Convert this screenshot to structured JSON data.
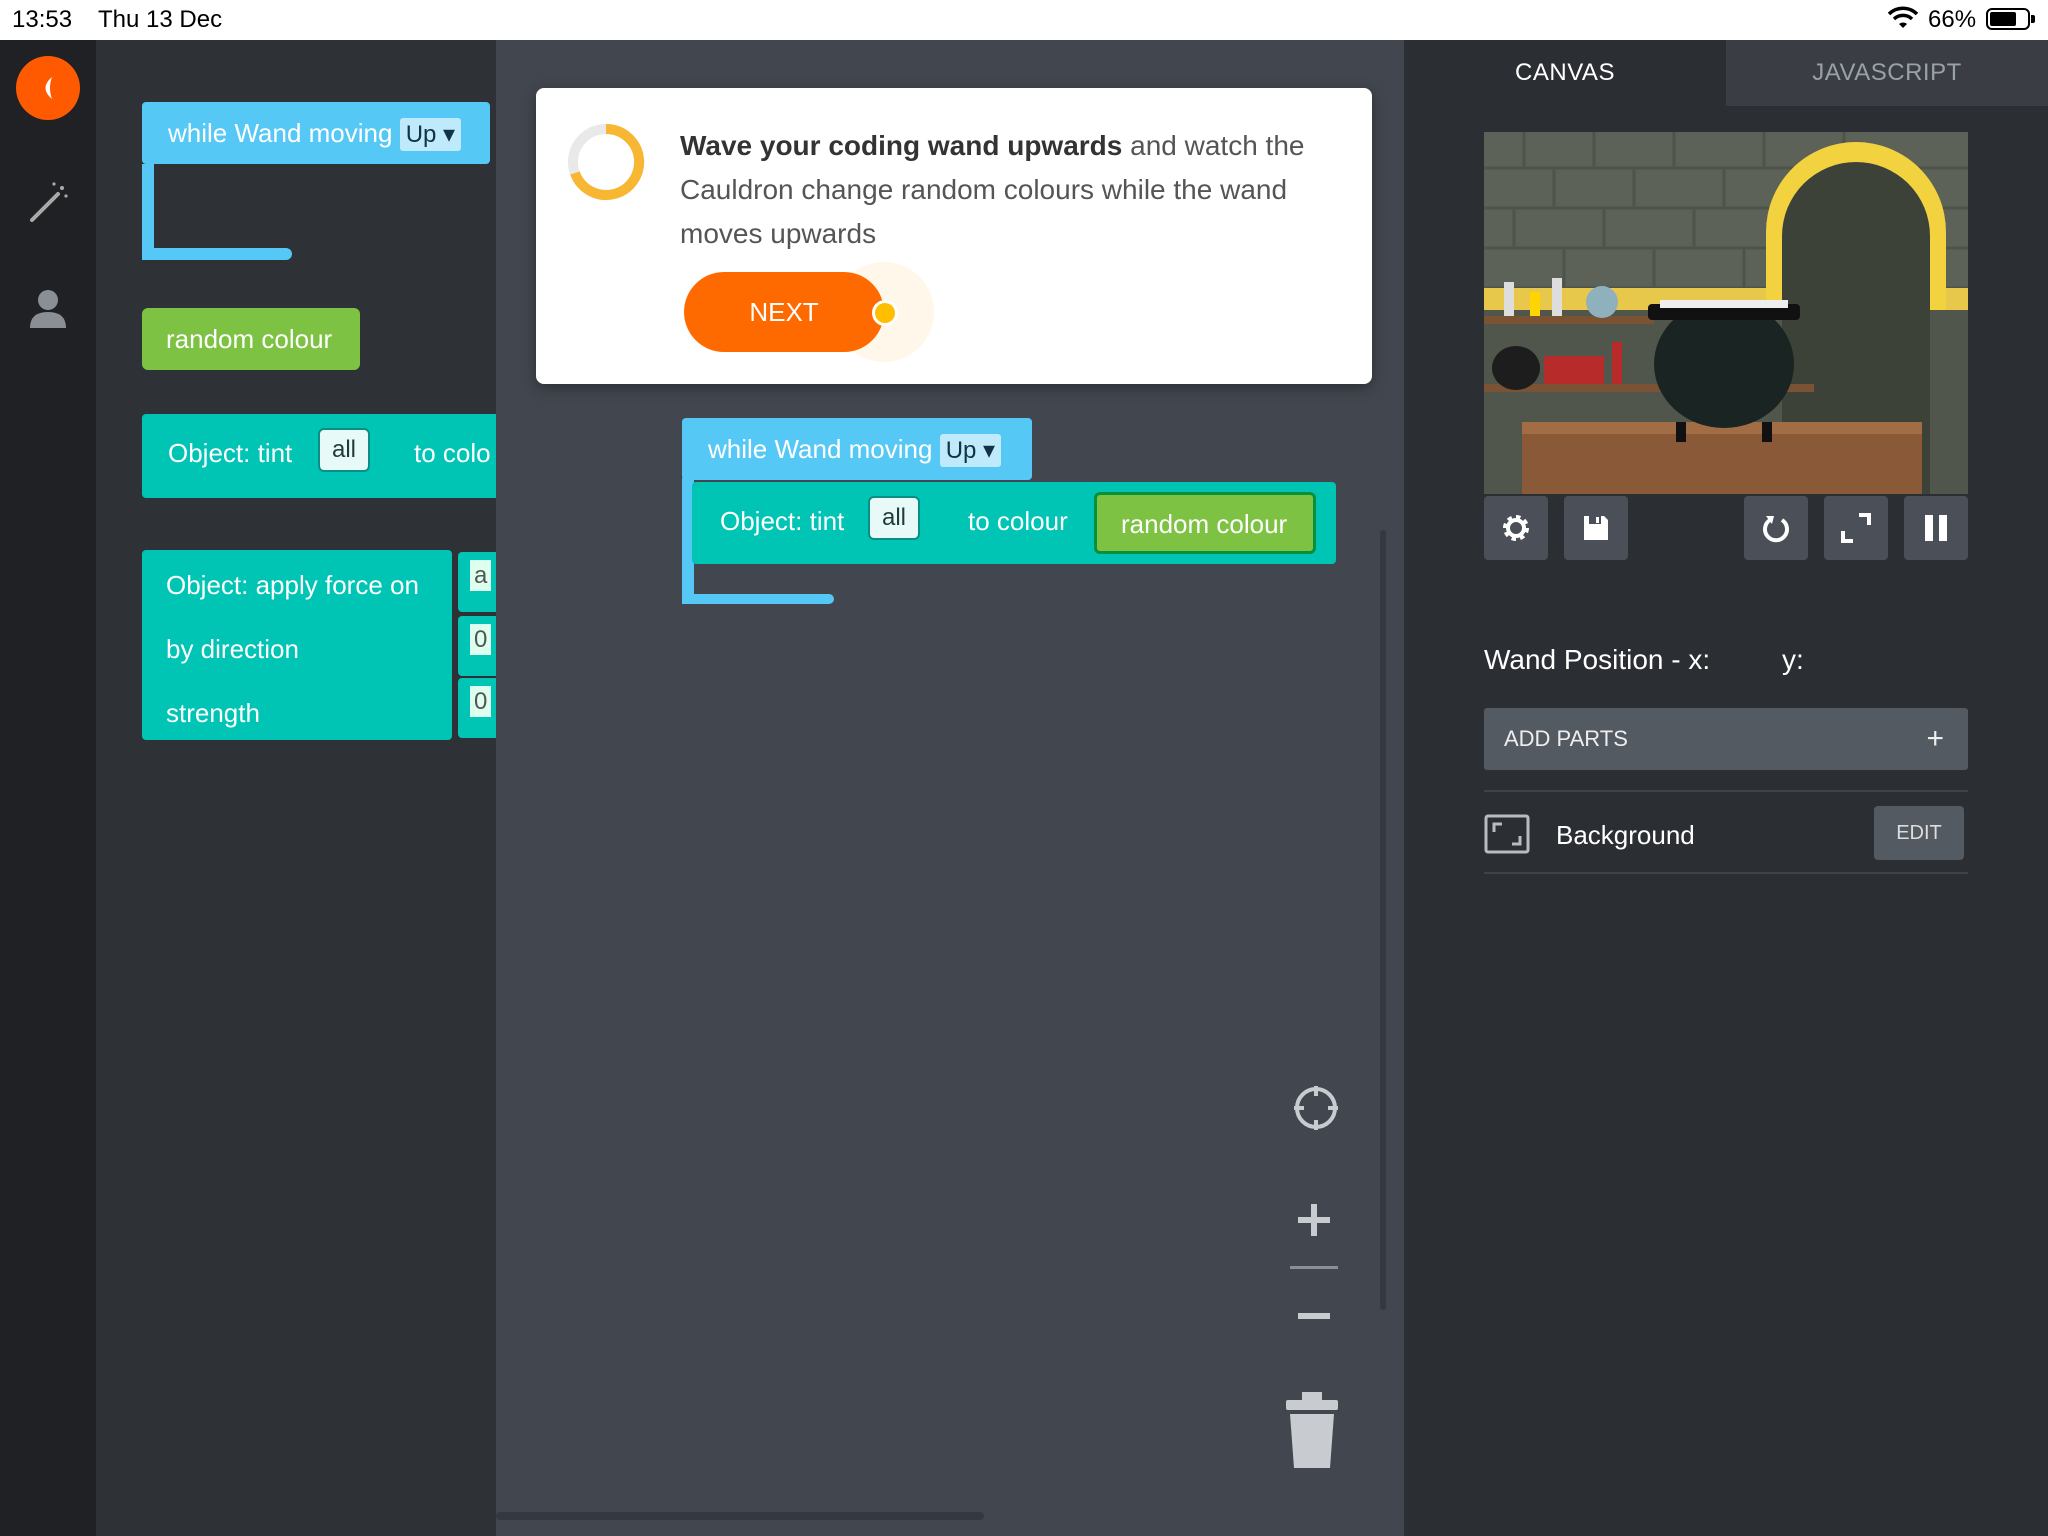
{
  "status_bar": {
    "time": "13:53",
    "date": "Thu 13 Dec",
    "battery": "66%",
    "battery_level": 0.66
  },
  "palette": {
    "while_label": "while Wand moving",
    "while_option": "Up",
    "random_colour": "random colour",
    "tint_label": "Object: tint",
    "tint_target": "all",
    "tint_to": "to colo",
    "force_label": "Object: apply force on",
    "force_direction": "by direction",
    "force_strength": "strength",
    "force_chip_1": "a",
    "force_chip_2": "0",
    "force_chip_3": "0"
  },
  "tutorial": {
    "bold": "Wave your coding wand upwards",
    "rest": " and watch the Cauldron change random colours while the wand moves upwards",
    "next": "NEXT"
  },
  "workspace": {
    "while_label": "while Wand moving",
    "while_option": "Up",
    "tint_label": "Object: tint",
    "tint_target": "all",
    "tint_to": "to colour",
    "colour_value": "random colour"
  },
  "right_panel": {
    "tabs": [
      "CANVAS",
      "JAVASCRIPT"
    ],
    "active_tab": "CANVAS",
    "wand_position_x_label": "Wand Position - x:",
    "wand_position_y_label": "y:",
    "add_parts": "ADD PARTS",
    "add_icon": "+",
    "part_name": "Background",
    "edit": "EDIT"
  },
  "colors": {
    "accent": "#ff6a00",
    "cyan_block": "#56c8f5",
    "teal_block": "#00c4b4",
    "green_block": "#7dc242",
    "progress_ring": "#f7b733"
  },
  "icons": [
    "back-icon",
    "wand-icon",
    "user-icon",
    "gear-icon",
    "save-icon",
    "restart-icon",
    "fullscreen-icon",
    "pause-icon",
    "recenter-icon",
    "zoom-in-icon",
    "zoom-out-icon",
    "trash-icon",
    "background-frame-icon",
    "wifi-icon",
    "battery-icon"
  ]
}
